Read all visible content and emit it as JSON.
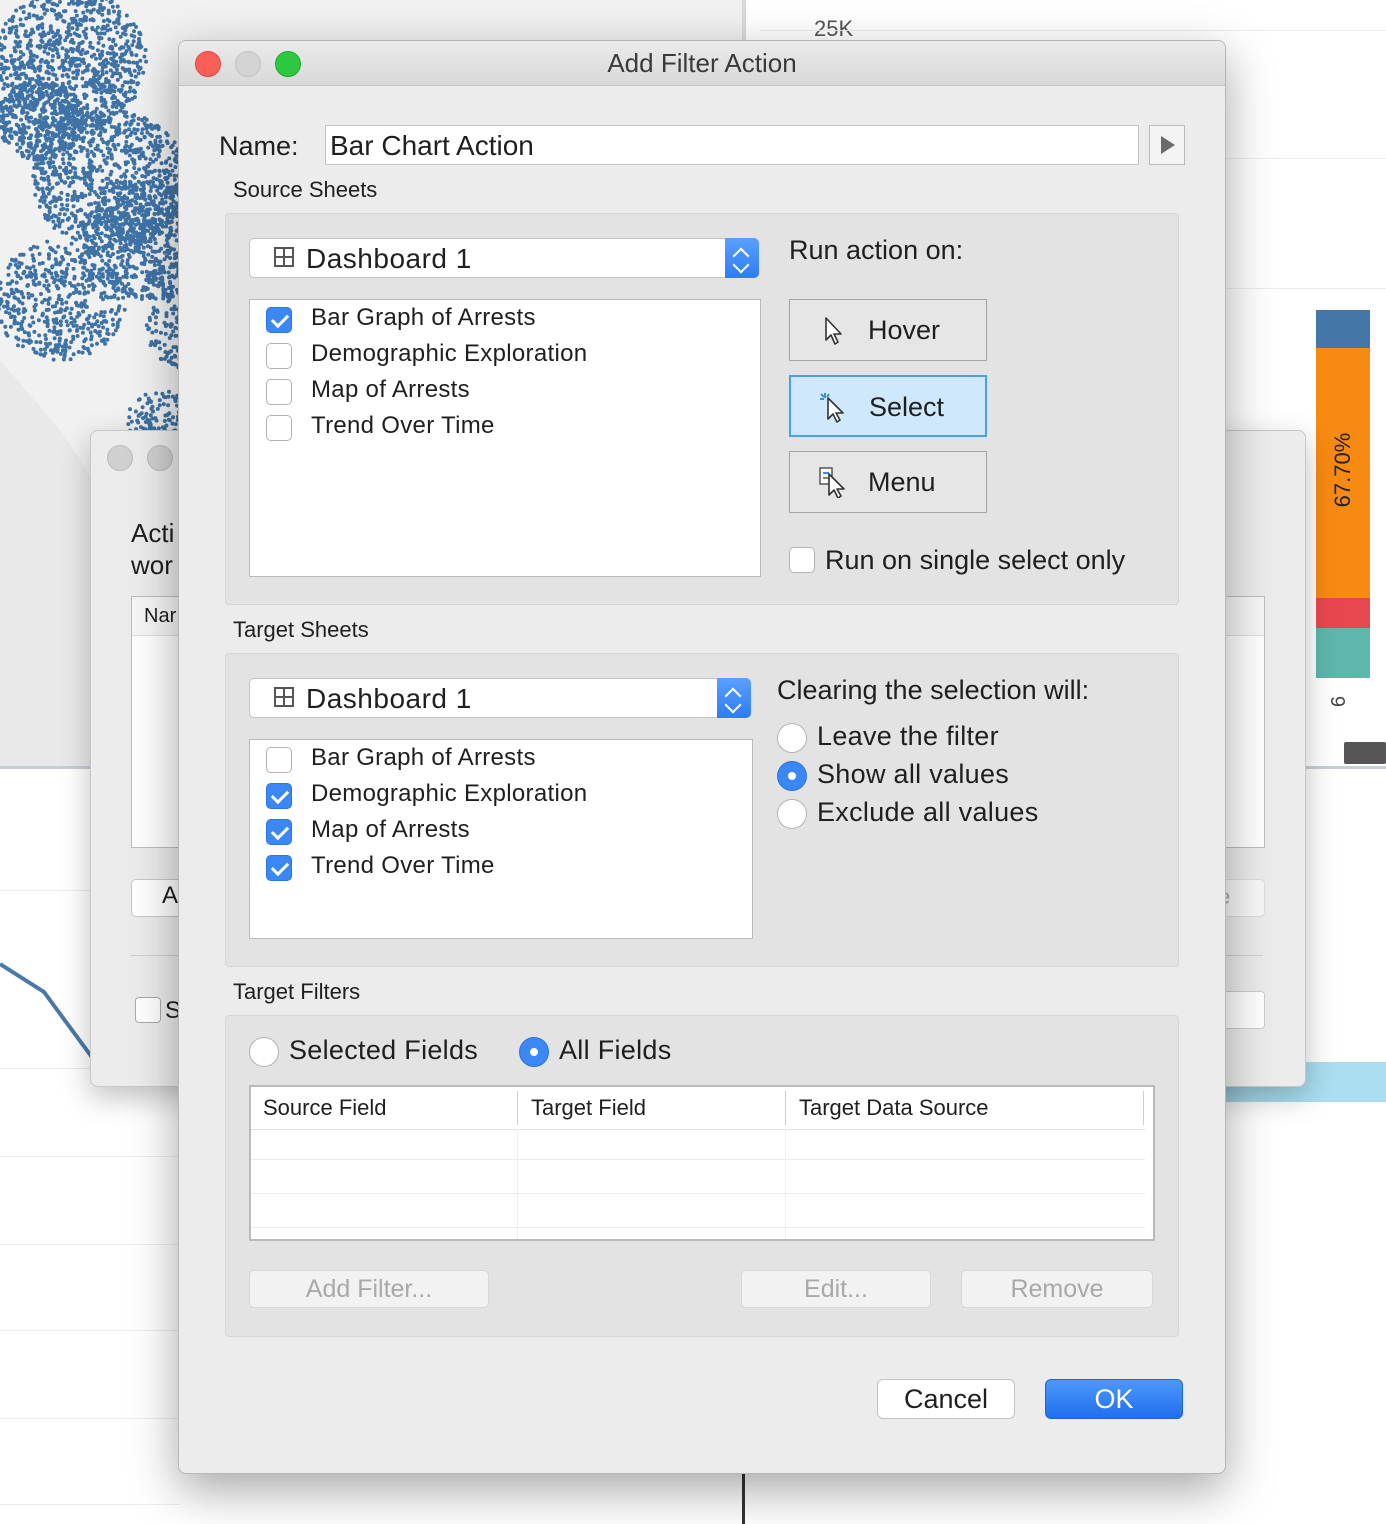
{
  "background": {
    "axis_label": "25K",
    "percent_label": "67.70%",
    "tick_label": "6",
    "stack_colors": [
      "#4476a8",
      "#f78a12",
      "#e9474f",
      "#5eb6ad"
    ],
    "behind_dialog": {
      "description_line1": "Acti",
      "description_line2": "wor",
      "list_header": "Nar",
      "left_button": "A",
      "right_button": "e",
      "checkbox_label": "S"
    }
  },
  "dialog": {
    "title": "Add Filter Action",
    "name_label": "Name:",
    "name_value": "Bar Chart Action",
    "source": {
      "section_label": "Source Sheets",
      "dropdown_value": "Dashboard 1",
      "sheets": [
        {
          "label": "Bar Graph of Arrests",
          "checked": true
        },
        {
          "label": "Demographic Exploration",
          "checked": false
        },
        {
          "label": "Map of Arrests",
          "checked": false
        },
        {
          "label": "Trend Over Time",
          "checked": false
        }
      ],
      "run_action_label": "Run action on:",
      "actions": [
        {
          "label": "Hover",
          "icon": "pointer-icon",
          "selected": false
        },
        {
          "label": "Select",
          "icon": "select-pointer-icon",
          "selected": true
        },
        {
          "label": "Menu",
          "icon": "menu-pointer-icon",
          "selected": false
        }
      ],
      "single_select_label": "Run on single select only",
      "single_select_checked": false
    },
    "target": {
      "section_label": "Target Sheets",
      "dropdown_value": "Dashboard 1",
      "sheets": [
        {
          "label": "Bar Graph of Arrests",
          "checked": false
        },
        {
          "label": "Demographic Exploration",
          "checked": true
        },
        {
          "label": "Map of Arrests",
          "checked": true
        },
        {
          "label": "Trend Over Time",
          "checked": true
        }
      ],
      "clearing_label": "Clearing the selection will:",
      "clearing_options": [
        {
          "label": "Leave the filter",
          "selected": false
        },
        {
          "label": "Show all values",
          "selected": true
        },
        {
          "label": "Exclude all values",
          "selected": false
        }
      ]
    },
    "filters": {
      "section_label": "Target Filters",
      "selected_fields_label": "Selected Fields",
      "all_fields_label": "All Fields",
      "mode": "All Fields",
      "columns": [
        "Source Field",
        "Target Field",
        "Target Data Source"
      ],
      "rows": [],
      "add_filter_label": "Add Filter...",
      "edit_label": "Edit...",
      "remove_label": "Remove"
    },
    "cancel_label": "Cancel",
    "ok_label": "OK"
  }
}
